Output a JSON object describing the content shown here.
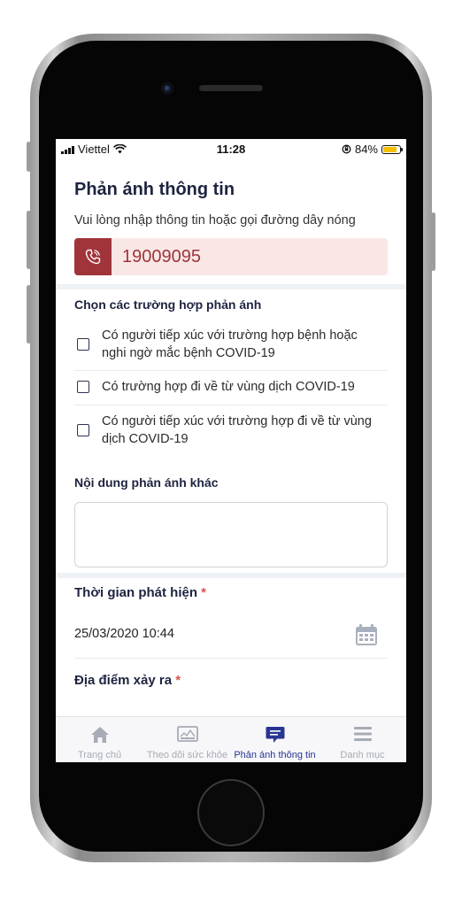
{
  "status_bar": {
    "carrier": "Viettel",
    "time": "11:28",
    "battery": "84%"
  },
  "header": {
    "title": "Phản ánh thông tin",
    "subtitle": "Vui lòng nhập thông tin hoặc gọi đường dây nóng",
    "hotline": "19009095"
  },
  "cases": {
    "label": "Chọn các trường hợp phản ánh",
    "options": [
      {
        "line1": "Có người tiếp xúc với trường hợp bệnh hoặc",
        "line2": "nghi ngờ mắc bệnh COVID-19",
        "checked": false
      },
      {
        "line1": "Có trường hợp đi về từ vùng dịch COVID-19",
        "line2": "",
        "checked": false
      },
      {
        "line1": "Có người tiếp xúc với trường hợp đi về từ vùng",
        "line2": "dịch COVID-19",
        "checked": false
      }
    ]
  },
  "other": {
    "label": "Nội dung phản ánh khác",
    "value": ""
  },
  "time": {
    "label": "Thời gian phát hiện",
    "required_mark": "*",
    "value": "25/03/2020 10:44"
  },
  "place": {
    "label": "Địa điểm xảy ra",
    "required_mark": "*"
  },
  "tabs": [
    {
      "label": "Trang chủ",
      "icon": "home-icon"
    },
    {
      "label": "Theo dõi sức khỏe",
      "icon": "health-chart-icon"
    },
    {
      "label": "Phản ánh thông tin",
      "icon": "feedback-chat-icon",
      "active": true
    },
    {
      "label": "Danh mục",
      "icon": "menu-icon"
    }
  ],
  "colors": {
    "accent": "#283593",
    "hotline_red": "#a0343a",
    "hotline_bg": "#f9e7e6",
    "required": "#d9534f"
  }
}
